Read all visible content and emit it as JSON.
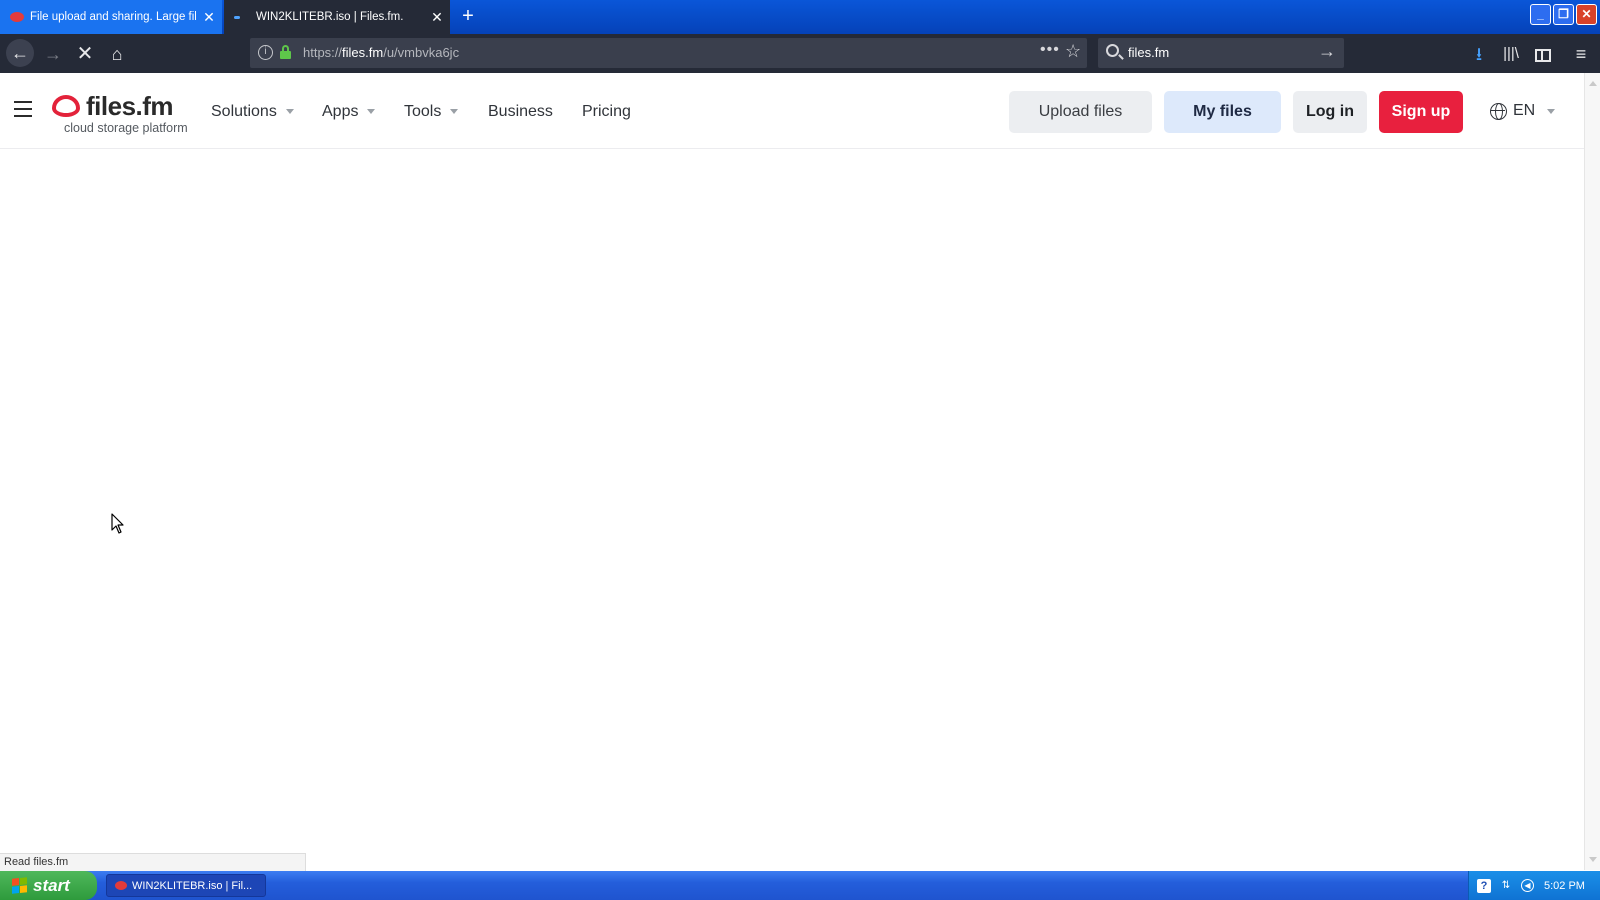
{
  "browser": {
    "tabs": [
      {
        "title": "File upload and sharing. Large file",
        "active": false
      },
      {
        "title": "WIN2KLITEBR.iso | Files.fm.",
        "active": true
      }
    ],
    "new_tab_glyph": "+",
    "tab_close_glyph": "✕",
    "window_buttons": {
      "minimize": "_",
      "maximize": "❐",
      "close": "✕"
    },
    "url": {
      "scheme": "https://",
      "host": "files.fm",
      "path": "/u/vmbvka6jc"
    },
    "search_text": "files.fm",
    "icons": {
      "back": "←",
      "forward": "→",
      "stop": "✕",
      "home": "⌂",
      "page_actions": "•••",
      "bookmark": "☆",
      "search_go": "→",
      "downloads": "⭳",
      "library": "|||\\",
      "menu": "≡",
      "info": "i"
    }
  },
  "site": {
    "logo": {
      "name": "files.fm",
      "tagline": "cloud storage platform"
    },
    "nav": {
      "solutions": "Solutions",
      "apps": "Apps",
      "tools": "Tools",
      "business": "Business",
      "pricing": "Pricing"
    },
    "buttons": {
      "upload": "Upload files",
      "my_files": "My files",
      "login": "Log in",
      "signup": "Sign up"
    },
    "language": "EN"
  },
  "status_bar": "Read files.fm",
  "taskbar": {
    "start_label": "start",
    "window_item": "WIN2KLITEBR.iso | Fil...",
    "clock": "5:02 PM",
    "tray_help": "?"
  },
  "colors": {
    "signup_red": "#e8203e",
    "my_files_blue": "#dde9fb",
    "logo_red": "#e3223a",
    "browser_dark": "#252a37",
    "xp_blue": "#245edb"
  }
}
